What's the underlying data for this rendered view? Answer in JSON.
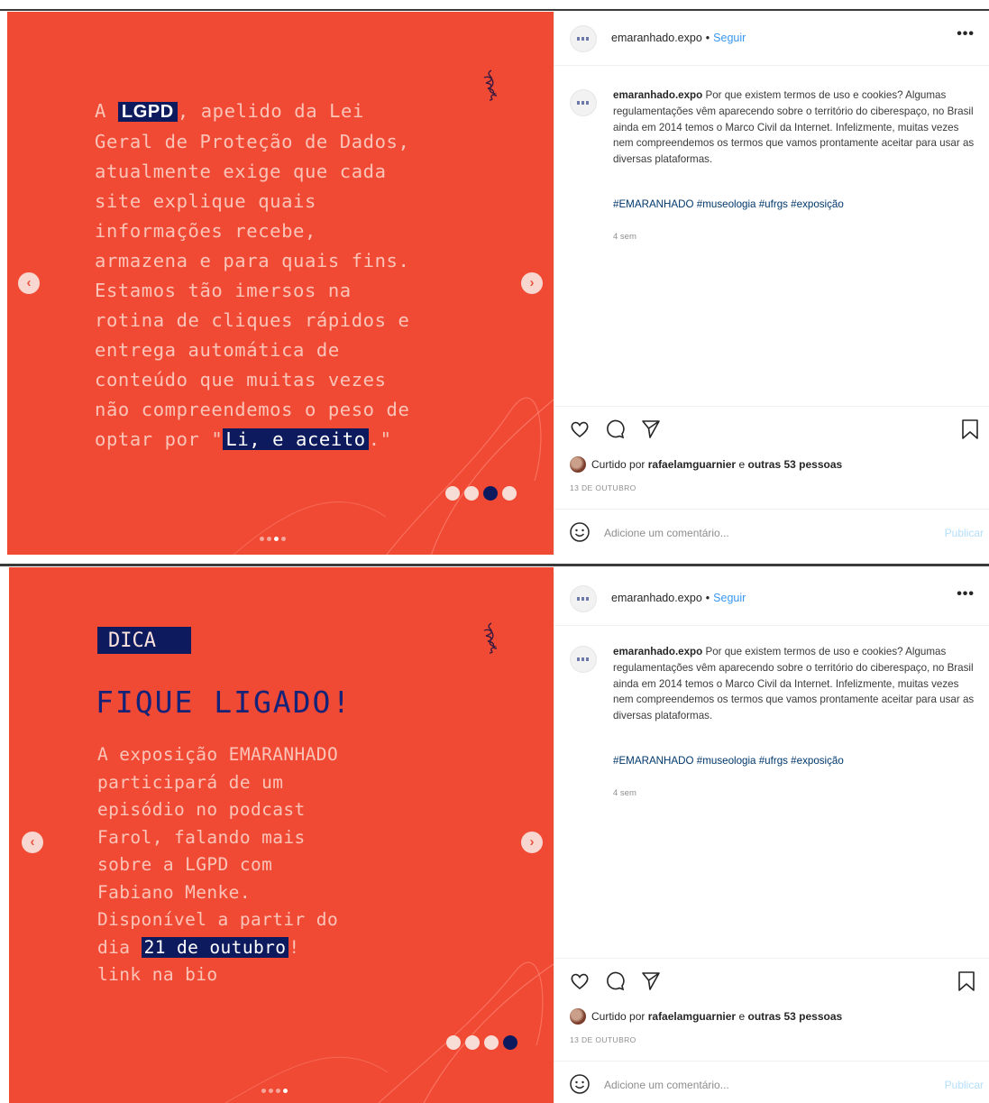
{
  "posts": [
    {
      "slide": {
        "lines": [
          {
            "pre": "A ",
            "hl": "LGPD",
            "post": ", apelido da Lei"
          },
          {
            "text": "Geral de Proteção de Dados,"
          },
          {
            "text": "atualmente exige que cada"
          },
          {
            "text": "site explique quais"
          },
          {
            "text": "informações recebe,"
          },
          {
            "text": "armazena e para quais fins."
          },
          {
            "text": "Estamos tão imersos na"
          },
          {
            "text": "rotina de cliques rápidos e"
          },
          {
            "text": "entrega automática de"
          },
          {
            "text": "conteúdo que muitas vezes"
          },
          {
            "text": "não compreendemos o peso de"
          },
          {
            "pre": "optar por \"",
            "hl": "Li, e aceito",
            "post": ".\""
          }
        ],
        "nav_prev": "‹",
        "nav_next": "›",
        "inner_active_dot": 3,
        "outer_active_dot": 3
      },
      "panel": {
        "username": "emaranhado.expo",
        "separator": "•",
        "follow": "Seguir",
        "more": "•••",
        "caption_user": "emaranhado.expo",
        "caption": "Por que existem termos de uso e cookies? Algumas regulamentações vêm aparecendo sobre o território do ciberespaço, no Brasil ainda em 2014 temos o Marco Civil da Internet. Infelizmente, muitas vezes nem compreendemos os termos que vamos prontamente aceitar para usar as diversas plataformas.",
        "hashtags": "#EMARANHADO #museologia #ufrgs #exposição",
        "age": "4 sem",
        "liked_prefix": "Curtido por",
        "liked_user": "rafaelamguarnier",
        "liked_and": "e",
        "liked_others": "outras 53 pessoas",
        "date": "13 DE OUTUBRO",
        "comment_placeholder": "Adicione um comentário...",
        "publish": "Publicar"
      }
    },
    {
      "slide": {
        "tag": "DICA",
        "title": "FIQUE LIGADO!",
        "lines": [
          {
            "text": "A exposição EMARANHADO"
          },
          {
            "text": "participará de um"
          },
          {
            "text": "episódio no podcast"
          },
          {
            "text": "Farol, falando mais"
          },
          {
            "text": "sobre a LGPD com"
          },
          {
            "text": "Fabiano Menke."
          },
          {
            "text": "Disponível a partir do"
          },
          {
            "pre": "dia ",
            "hl": "21 de outubro",
            "post": "!"
          },
          {
            "text": "link na bio"
          }
        ],
        "nav_prev": "‹",
        "nav_next": "›",
        "inner_active_dot": 4,
        "outer_active_dot": 4
      },
      "panel": {
        "username": "emaranhado.expo",
        "separator": "•",
        "follow": "Seguir",
        "more": "•••",
        "caption_user": "emaranhado.expo",
        "caption": "Por que existem termos de uso e cookies? Algumas regulamentações vêm aparecendo sobre o território do ciberespaço, no Brasil ainda em 2014 temos o Marco Civil da Internet. Infelizmente, muitas vezes nem compreendemos os termos que vamos prontamente aceitar para usar as diversas plataformas.",
        "hashtags": "#EMARANHADO #museologia #ufrgs #exposição",
        "age": "4 sem",
        "liked_prefix": "Curtido por",
        "liked_user": "rafaelamguarnier",
        "liked_and": "e",
        "liked_others": "outras 53 pessoas",
        "date": "13 DE OUTUBRO",
        "comment_placeholder": "Adicione um comentário...",
        "publish": "Publicar"
      }
    }
  ],
  "colors": {
    "slide_bg": "#f04a35",
    "slide_text": "#fbc4b8",
    "highlight_bg": "#0e1a5e",
    "title_blue": "#142278",
    "follow_blue": "#3897f0",
    "hashtag_blue": "#00376b"
  },
  "icons": [
    "heart-icon",
    "comment-icon",
    "share-icon",
    "bookmark-icon",
    "smile-icon",
    "chevron-left-icon",
    "chevron-right-icon",
    "more-icon"
  ]
}
